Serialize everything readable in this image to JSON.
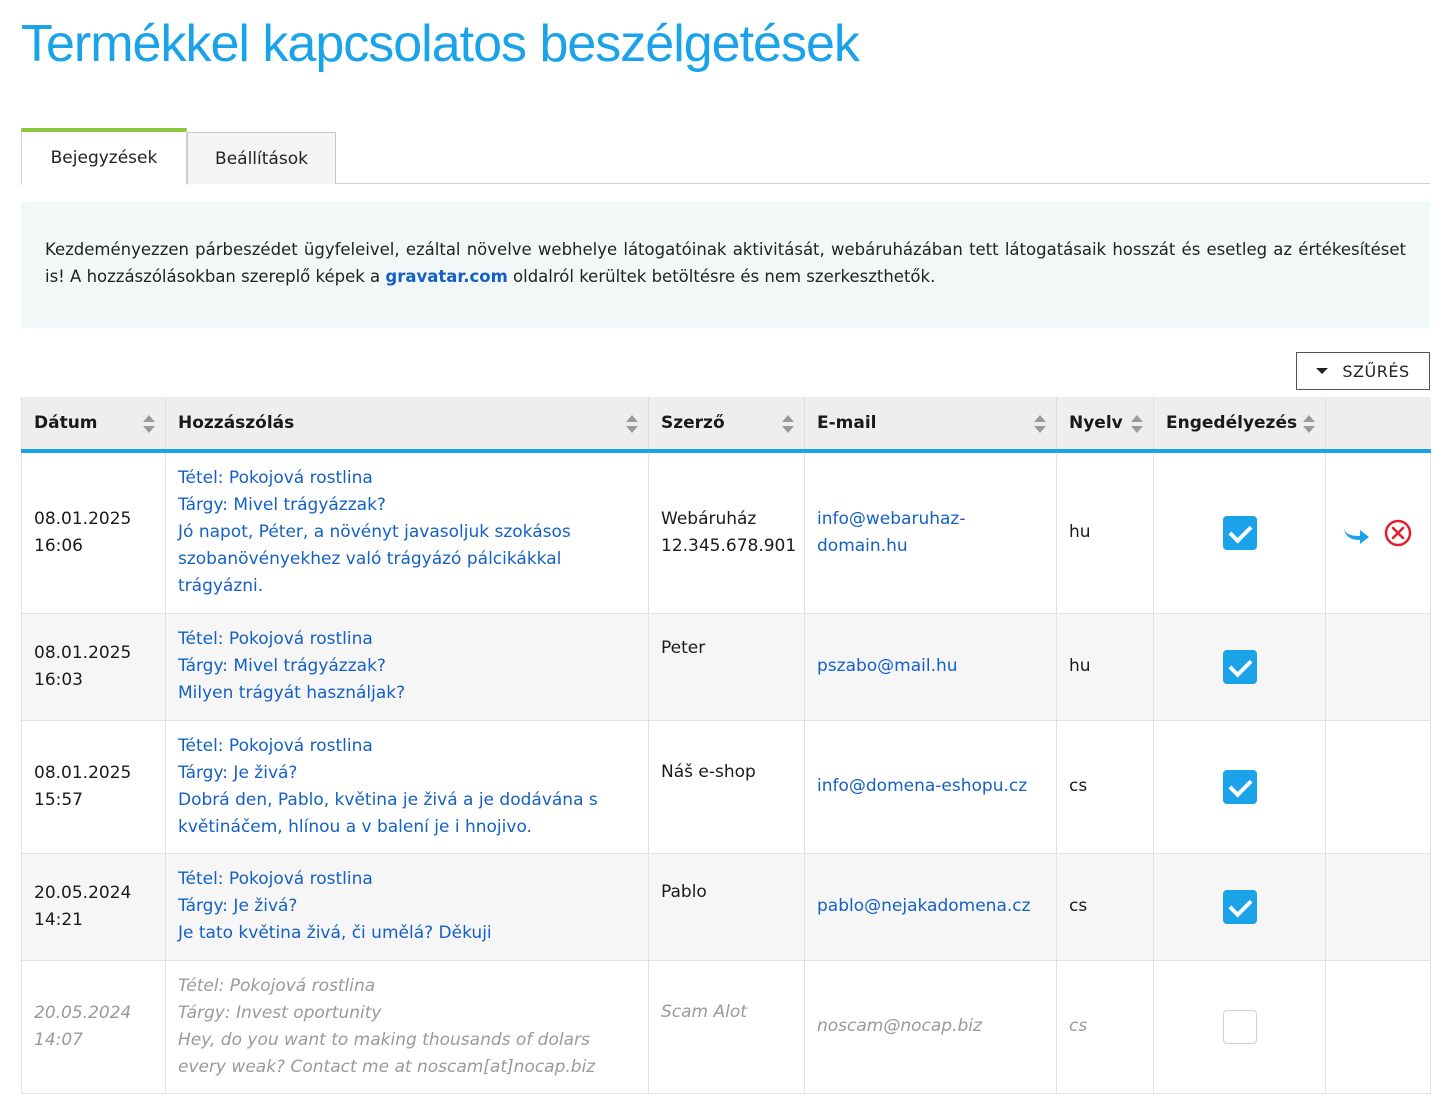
{
  "page": {
    "title": "Termékkel kapcsolatos beszélgetések"
  },
  "tabs": [
    {
      "label": "Bejegyzések",
      "active": true
    },
    {
      "label": "Beállítások",
      "active": false
    }
  ],
  "info": {
    "text_before": "Kezdeményezzen párbeszédet ügyfeleivel, ezáltal növelve webhelye látogatóinak aktivitását, webáruházában tett látogatásaik hosszát és esetleg az értékesítéset is! A hozzászólásokban szereplő képek a ",
    "link": "gravatar.com",
    "text_after": " oldalról kerültek betöltésre és nem szerkeszthetők."
  },
  "filter": {
    "label": "SZŰRÉS",
    "icon": "caret-down-icon"
  },
  "table": {
    "headers": {
      "date": "Dátum",
      "comment": "Hozzászólás",
      "author": "Szerző",
      "email": "E-mail",
      "language": "Nyelv",
      "approval": "Engedélyezés"
    },
    "rows": [
      {
        "date": "08.01.2025",
        "time": "16:06",
        "item": "Tétel: Pokojová rostlina",
        "subject": "Tárgy: Mivel trágyázzak?",
        "message": "Jó napot, Péter, a növényt javasoljuk szokásos szobanövényekhez való trágyázó pálcikákkal trágyázni.",
        "author": "Webáruház",
        "author_line2": "12.345.678.901",
        "email_line1": "info@webaruhaz-",
        "email_line2": "domain.hu",
        "language": "hu",
        "approved": true
      },
      {
        "date": "08.01.2025",
        "time": "16:03",
        "item": "Tétel: Pokojová rostlina",
        "subject": "Tárgy: Mivel trágyázzak?",
        "message": "Milyen trágyát használjak?",
        "author": "Peter",
        "author_line2": "",
        "email_line1": "pszabo@mail.hu",
        "email_line2": "",
        "language": "hu",
        "approved": true
      },
      {
        "date": "08.01.2025",
        "time": "15:57",
        "item": "Tétel: Pokojová rostlina",
        "subject": "Tárgy: Je živá?",
        "message": "Dobrá den, Pablo, květina je živá a je dodávána s květináčem, hlínou a v balení je i hnojivo.",
        "author": "Náš e-shop",
        "author_line2": "",
        "email_line1": "info@domena-eshopu.cz",
        "email_line2": "",
        "language": "cs",
        "approved": true
      },
      {
        "date": "20.05.2024",
        "time": "14:21",
        "item": "Tétel: Pokojová rostlina",
        "subject": "Tárgy: Je živá?",
        "message": "Je tato květina živá, či umělá? Děkuji",
        "author": "Pablo",
        "author_line2": "",
        "email_line1": "pablo@nejakadomena.cz",
        "email_line2": "",
        "language": "cs",
        "approved": true
      },
      {
        "date": "20.05.2024",
        "time": "14:07",
        "item": "Tétel: Pokojová rostlina",
        "subject": "Tárgy: Invest oportunity",
        "message": "Hey, do you want to making thousands of dolars every weak? Contact me at noscam[at]nocap.biz",
        "author": "Scam Alot",
        "author_line2": "",
        "email_line1": "noscam@nocap.biz",
        "email_line2": "",
        "language": "cs",
        "approved": false
      }
    ]
  },
  "row_actions": {
    "reply_icon": "reply-arrow-icon",
    "delete_icon": "delete-circle-icon"
  },
  "colors": {
    "accent": "#1aa3e8",
    "link": "#1560c4",
    "tab_active": "#8cc63f",
    "delete": "#e0202a"
  }
}
